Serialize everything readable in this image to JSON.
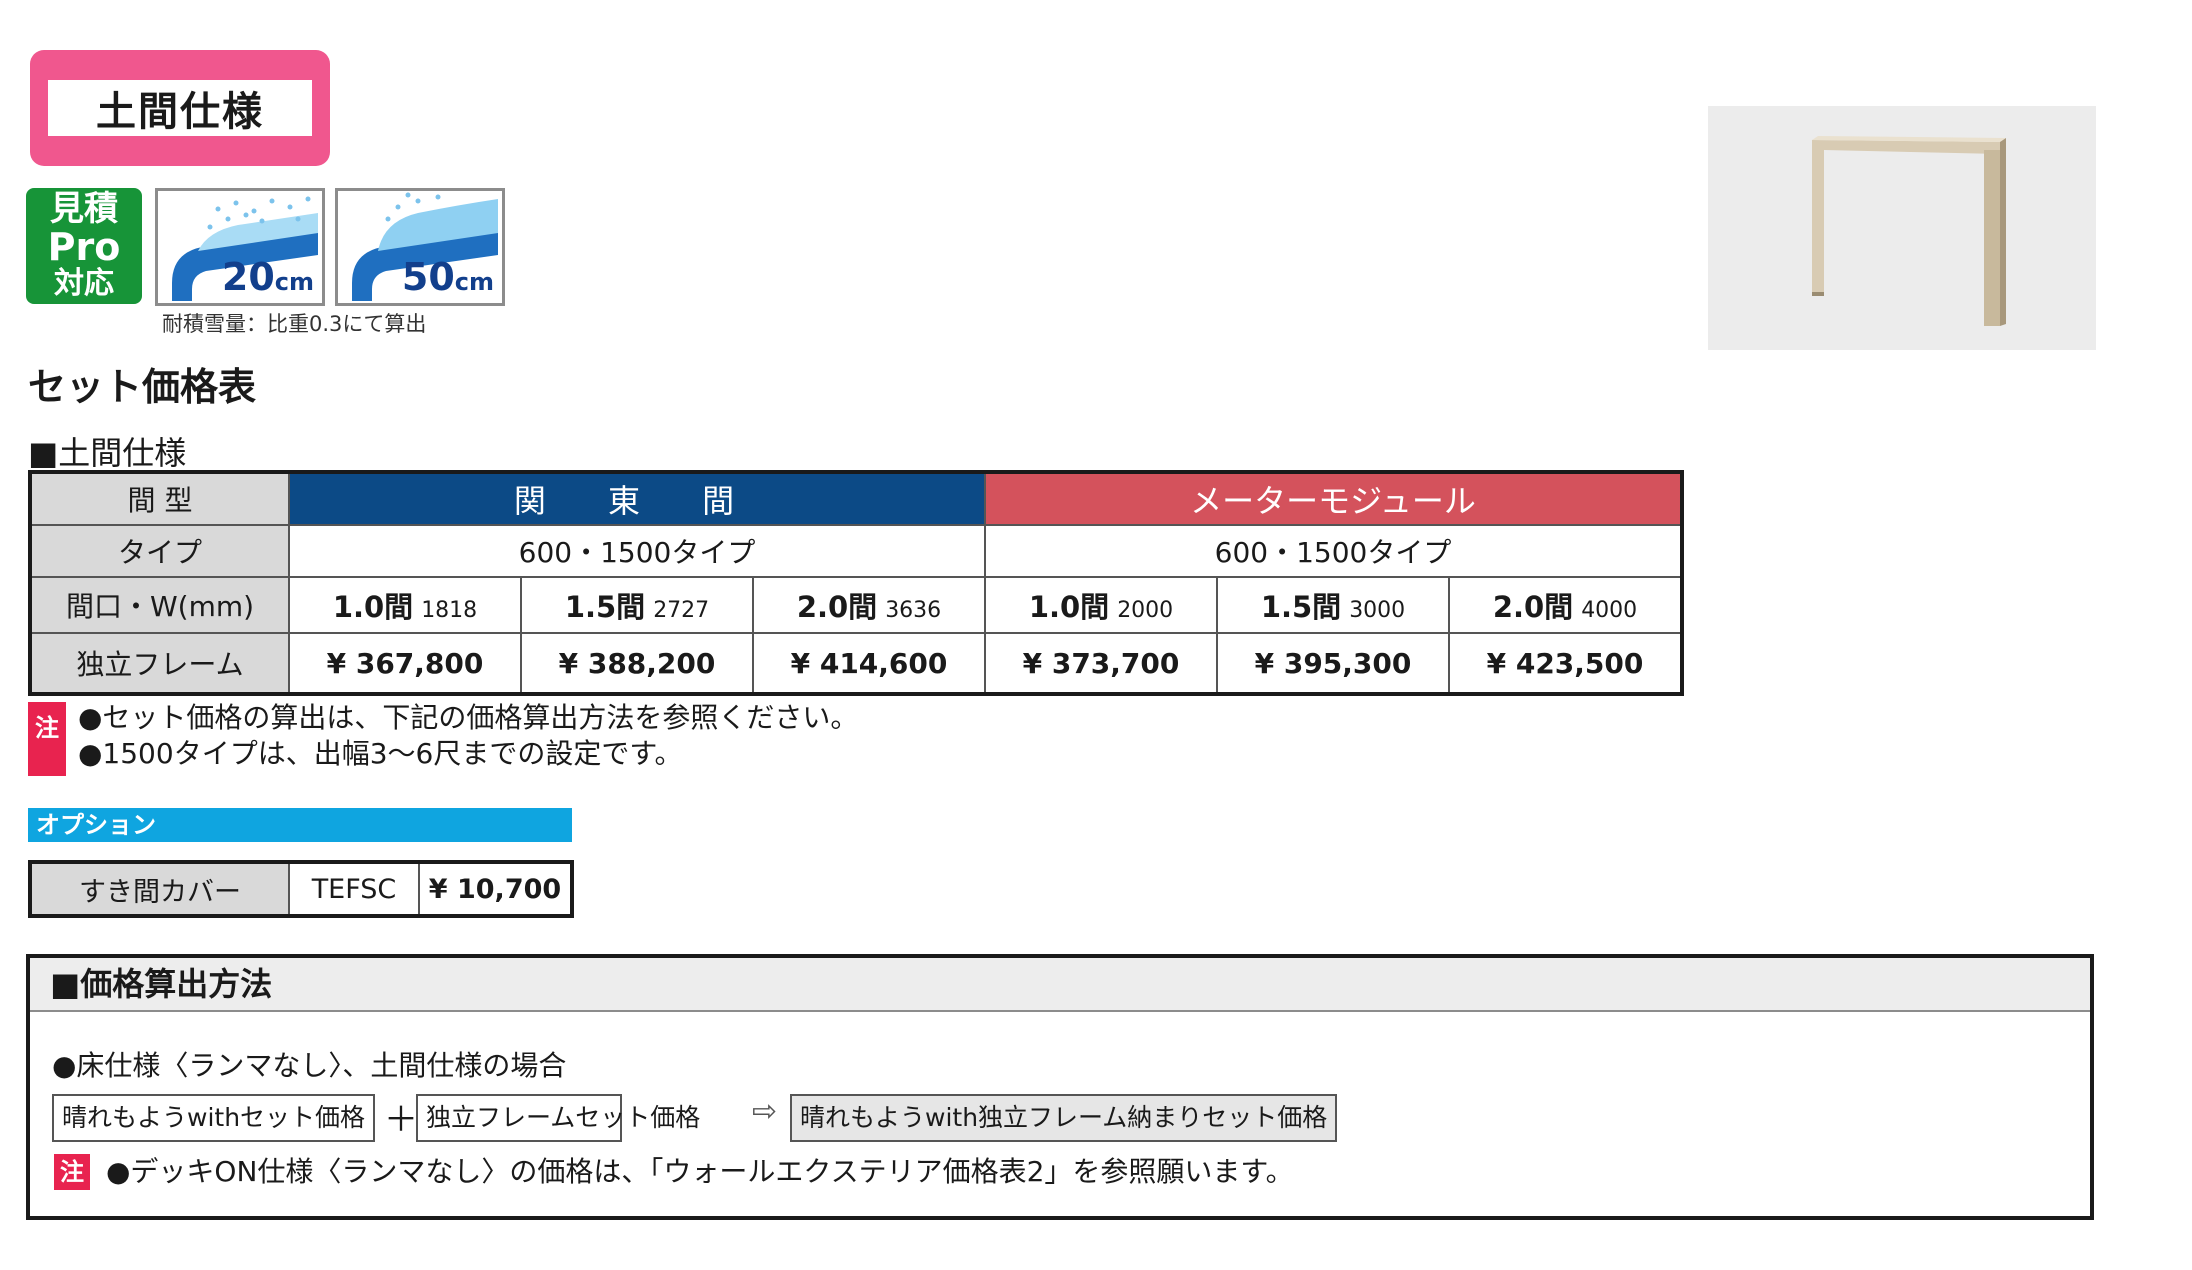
{
  "header": {
    "title": "土間仕様",
    "badge_pro": [
      "見積",
      "Pro",
      "対応"
    ],
    "snow_badges": [
      {
        "value": "20",
        "unit": "cm"
      },
      {
        "value": "50",
        "unit": "cm"
      }
    ],
    "snow_note": "耐積雪量：比重0.3にて算出"
  },
  "section_title": "セット価格表",
  "sub_title": "■土間仕様",
  "price_table": {
    "row_labels": [
      "間 型",
      "タイプ",
      "間口・W(mm)",
      "独立フレーム"
    ],
    "groups": [
      {
        "name": "関 東 間",
        "type": "600・1500タイプ",
        "sizes": [
          {
            "ken": "1.0間",
            "mm": "1818",
            "price": "¥ 367,800"
          },
          {
            "ken": "1.5間",
            "mm": "2727",
            "price": "¥ 388,200"
          },
          {
            "ken": "2.0間",
            "mm": "3636",
            "price": "¥ 414,600"
          }
        ]
      },
      {
        "name": "メーターモジュール",
        "type": "600・1500タイプ",
        "sizes": [
          {
            "ken": "1.0間",
            "mm": "2000",
            "price": "¥ 373,700"
          },
          {
            "ken": "1.5間",
            "mm": "3000",
            "price": "¥ 395,300"
          },
          {
            "ken": "2.0間",
            "mm": "4000",
            "price": "¥ 423,500"
          }
        ]
      }
    ],
    "colors": {
      "kanto": "#0c4a86",
      "meter": "#d4525c"
    }
  },
  "notes": {
    "badge": "注",
    "lines": [
      "●セット価格の算出は、下記の価格算出方法を参照ください。",
      "●1500タイプは、出幅3〜6尺までの設定です。"
    ]
  },
  "option": {
    "header": "オプション",
    "item": {
      "name": "すき間カバー",
      "code": "TEFSC",
      "price": "¥ 10,700"
    }
  },
  "calc": {
    "title": "■価格算出方法",
    "case": "●床仕様〈ランマなし〉、土間仕様の場合",
    "formula": {
      "a": "晴れもようwithセット価格",
      "plus": "＋",
      "b": "独立フレームセット価格",
      "arrow": "⇨",
      "c": "晴れもようwith独立フレーム納まりセット価格"
    },
    "note_badge": "注",
    "note": "●デッキON仕様〈ランマなし〉の価格は、「ウォールエクステリア価格表2」を参照願います。"
  }
}
